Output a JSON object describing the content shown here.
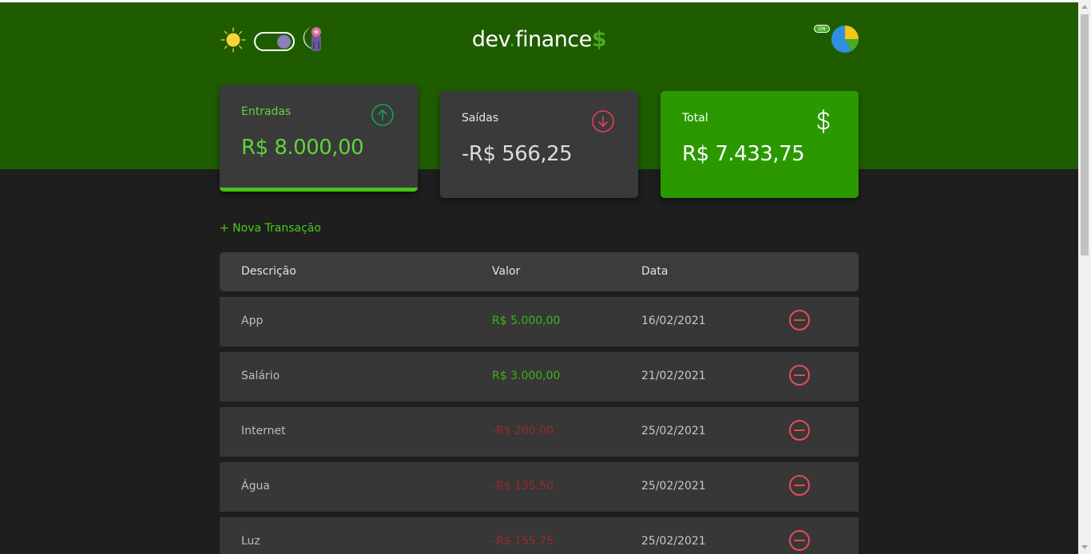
{
  "app": {
    "logo_main": "dev",
    "logo_dot": ".",
    "logo_name": "finance",
    "logo_dollar": "$",
    "chart_badge": "ON"
  },
  "theme": {
    "sun_icon": "sun-icon",
    "moon_icon": "moon-icon",
    "toggle_state": "dark"
  },
  "cards": {
    "income": {
      "title": "Entradas",
      "value": "R$ 8.000,00",
      "icon": "arrow-up-circle-icon"
    },
    "expense": {
      "title": "Saídas",
      "value": "-R$ 566,25",
      "icon": "arrow-down-circle-icon"
    },
    "total": {
      "title": "Total",
      "value": "R$ 7.433,75",
      "icon": "dollar-sign-icon"
    }
  },
  "new_transaction_label": "+ Nova Transação",
  "table": {
    "headers": {
      "description": "Descrição",
      "amount": "Valor",
      "date": "Data"
    },
    "rows": [
      {
        "description": "App",
        "amount": "R$ 5.000,00",
        "type": "income",
        "date": "16/02/2021"
      },
      {
        "description": "Salário",
        "amount": "R$ 3.000,00",
        "type": "income",
        "date": "21/02/2021"
      },
      {
        "description": "Internet",
        "amount": "-R$ 200,00",
        "type": "expense",
        "date": "25/02/2021"
      },
      {
        "description": "Água",
        "amount": "-R$ 135,50",
        "type": "expense",
        "date": "25/02/2021"
      },
      {
        "description": "Luz",
        "amount": "-R$ 155,75",
        "type": "expense",
        "date": "25/02/2021"
      }
    ]
  },
  "colors": {
    "header_bg": "#1f5c00",
    "accent_green": "#49aa26",
    "income_green": "#3bb51a",
    "expense_red": "#9b2a2a",
    "remove_red": "#e84c55",
    "total_card_bg": "#2b9800"
  }
}
